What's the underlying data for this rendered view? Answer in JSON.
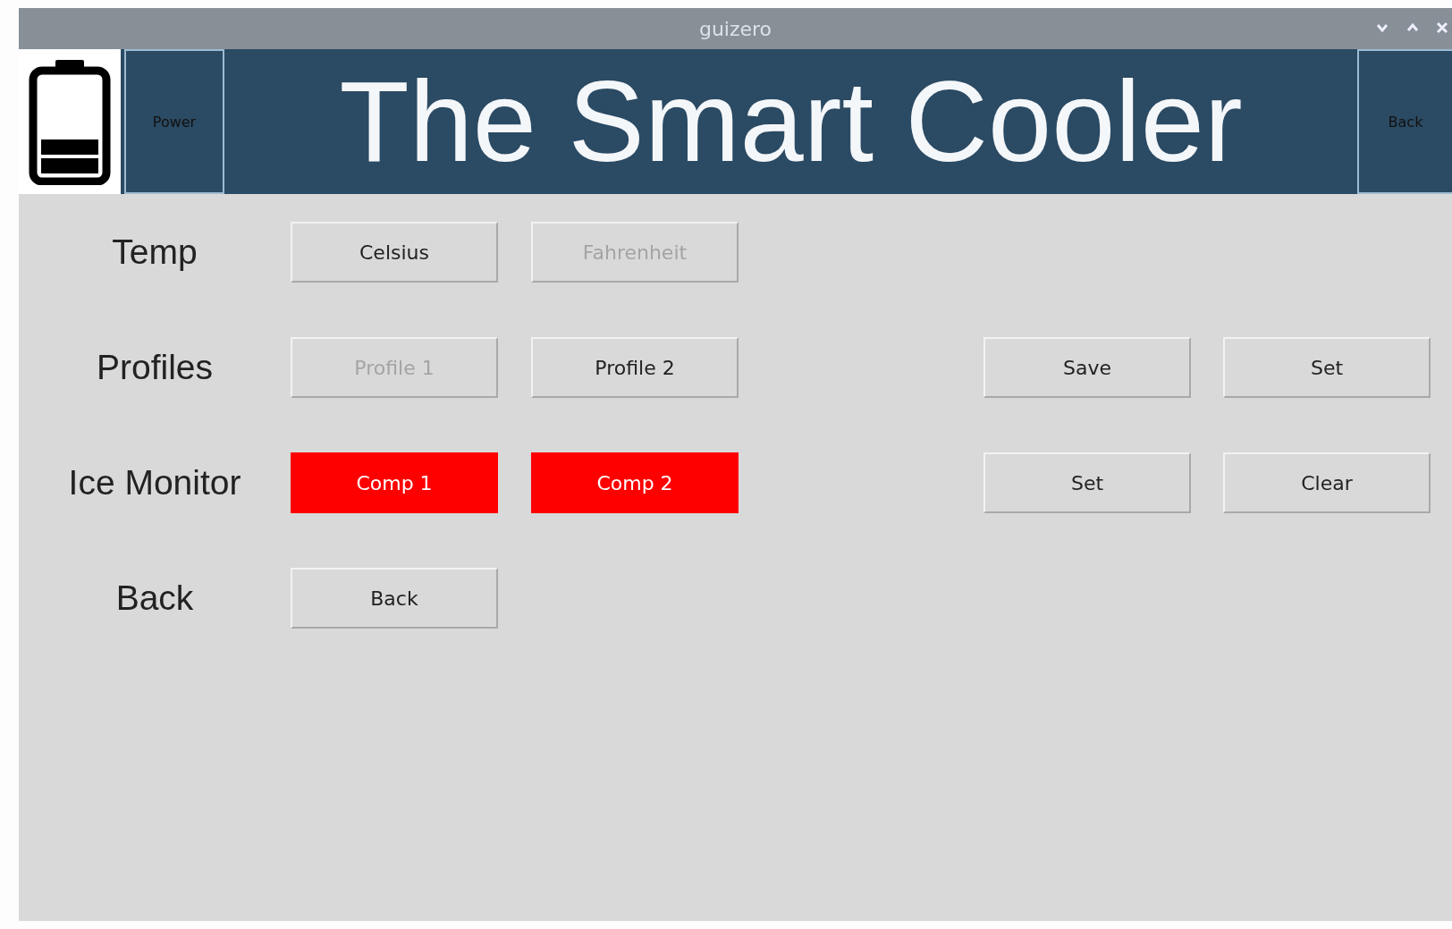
{
  "window": {
    "title": "guizero"
  },
  "header": {
    "power_button": "Power",
    "title": "The Smart Cooler",
    "back_button": "Back"
  },
  "rows": [
    {
      "label": "Temp",
      "buttons": [
        {
          "text": "Celsius",
          "disabled": false
        },
        {
          "text": "Fahrenheit",
          "disabled": true
        }
      ]
    },
    {
      "label": "Profiles",
      "buttons": [
        {
          "text": "Profile 1",
          "disabled": true
        },
        {
          "text": "Profile 2",
          "disabled": false
        }
      ],
      "side_buttons": [
        {
          "text": "Save",
          "disabled": false
        },
        {
          "text": "Set",
          "disabled": false
        }
      ]
    },
    {
      "label": "Ice Monitor",
      "buttons": [
        {
          "text": "Comp 1",
          "disabled": false,
          "color": "#ff0000"
        },
        {
          "text": "Comp 2",
          "disabled": false,
          "color": "#ff0000"
        }
      ],
      "side_buttons": [
        {
          "text": "Set",
          "disabled": false
        },
        {
          "text": "Clear",
          "disabled": false
        }
      ]
    },
    {
      "label": "Back",
      "buttons": [
        {
          "text": "Back",
          "disabled": false
        }
      ]
    }
  ]
}
